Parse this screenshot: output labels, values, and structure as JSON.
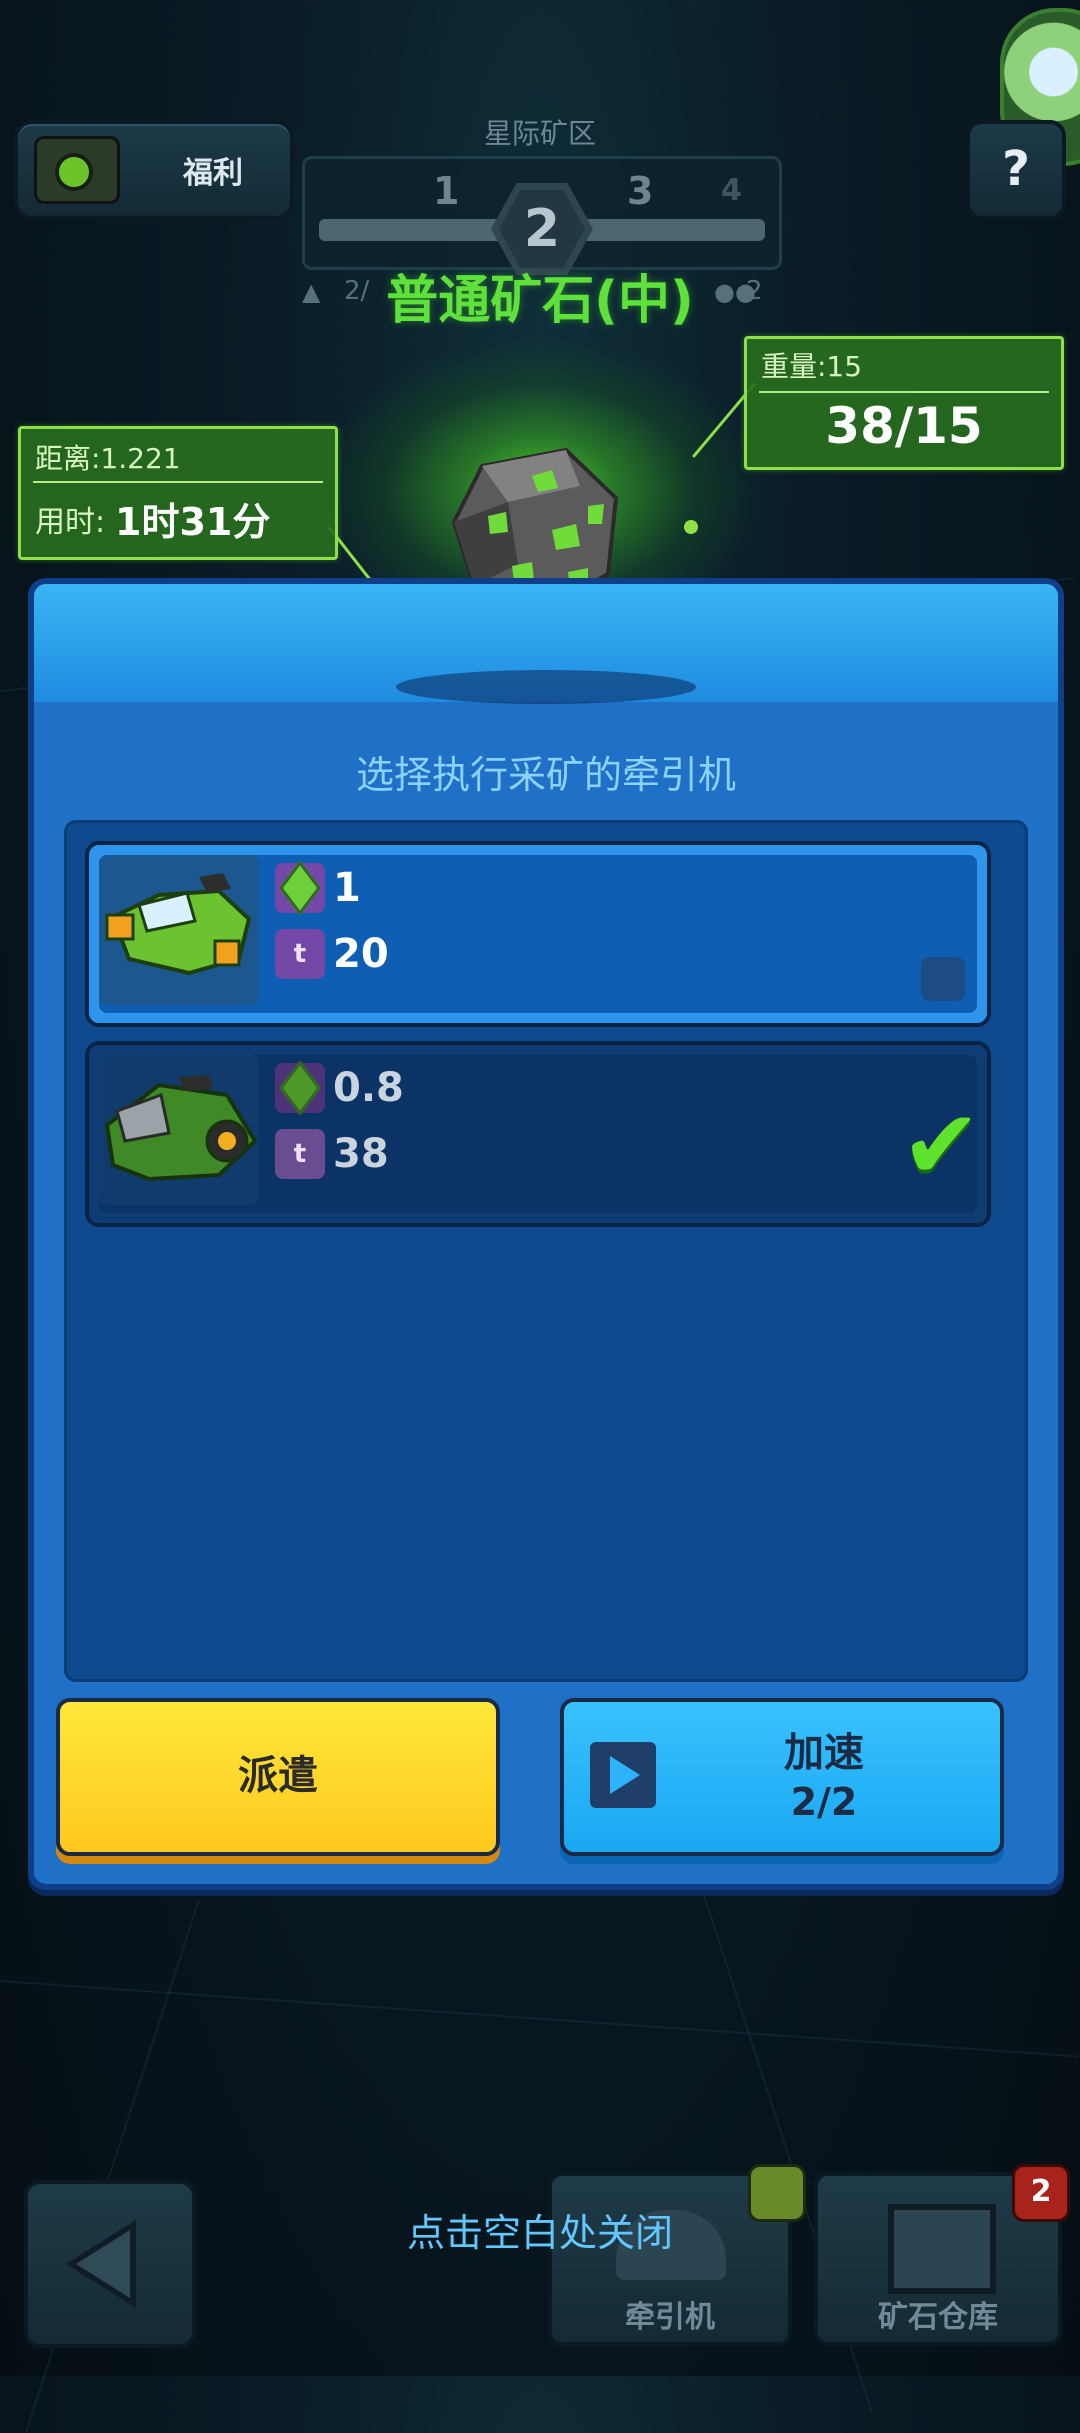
{
  "top": {
    "welfare_label": "福利",
    "zone_title": "星际矿区",
    "levels": [
      "1",
      "2",
      "3",
      "4"
    ],
    "current_level": "2",
    "help_label": "?"
  },
  "ore": {
    "title": "普通矿石(中)",
    "left_count": "2/",
    "right_count": "2",
    "weight_label": "重量:15",
    "weight_value": "38/15",
    "distance_label": "距离:1.221",
    "time_prefix": "用时:",
    "time_value": "1时31分"
  },
  "panel": {
    "subtitle": "选择执行采矿的牵引机",
    "tractors": [
      {
        "speed": "1",
        "capacity": "20",
        "selected": false
      },
      {
        "speed": "0.8",
        "capacity": "38",
        "selected": true
      }
    ],
    "dispatch_label": "派遣",
    "boost_label": "加速",
    "boost_count": "2/2",
    "capacity_icon_letter": "t"
  },
  "bottom": {
    "close_hint": "点击空白处关闭",
    "tab_tractor": "牵引机",
    "tab_warehouse": "矿石仓库",
    "warehouse_badge": "2"
  },
  "colors": {
    "ore_green": "#5ee13a",
    "panel_blue": "#1f70c7",
    "dispatch_yellow": "#ffd21e",
    "boost_blue": "#19a7f1"
  }
}
